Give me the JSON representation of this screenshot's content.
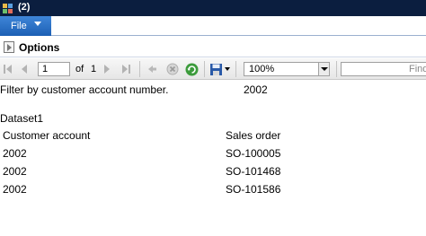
{
  "window": {
    "title": "(2)"
  },
  "ribbon": {
    "file_label": "File"
  },
  "options": {
    "label": "Options"
  },
  "toolbar": {
    "page_value": "1",
    "of_label": "of",
    "total_pages": "1",
    "zoom_value": "100%",
    "find_placeholder": "Find"
  },
  "report": {
    "filter_label": "Filter by customer account number.",
    "filter_value": "2002",
    "dataset_title": "Dataset1",
    "columns": [
      "Customer account",
      "Sales order"
    ],
    "rows": [
      [
        "2002",
        "SO-100005"
      ],
      [
        "2002",
        "SO-101468"
      ],
      [
        "2002",
        "SO-101586"
      ]
    ]
  },
  "colors": {
    "titlebar": "#0b1e3f",
    "file_tab": "#2b6fc4"
  }
}
